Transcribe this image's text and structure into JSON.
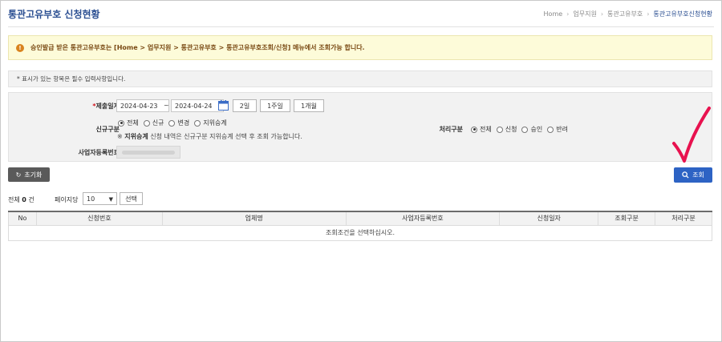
{
  "header": {
    "title": "통관고유부호 신청현황",
    "breadcrumb": [
      "Home",
      "업무지원",
      "통관고유부호",
      "통관고유부호신청현황"
    ]
  },
  "notice": {
    "text": "승인발급 받은 통관고유부호는 [Home > 업무지원 > 통관고유부호 > 통관고유부호조회/신청] 메뉴에서 조회가능 합니다."
  },
  "required_note": "* 표시가 있는 항목은 필수 입력사항입니다.",
  "form": {
    "submit_date": {
      "required_mark": "*",
      "label": "제출일자",
      "from": "2024-04-23",
      "tilde": "~",
      "to": "2024-04-24",
      "quick_buttons": [
        "2일",
        "1주일",
        "1개월"
      ]
    },
    "new_type": {
      "label": "신규구분",
      "options": [
        "전체",
        "신규",
        "변경",
        "지위승계"
      ],
      "selected": "전체",
      "hint_prefix": "※",
      "hint_bold": "지위승계",
      "hint_rest": "신청 내역은 신규구분 지위승계 선택 후 조회 가능합니다."
    },
    "process_type": {
      "label": "처리구분",
      "options": [
        "전체",
        "신청",
        "승인",
        "반려"
      ],
      "selected": "전체"
    },
    "business_no": {
      "label": "사업자등록번호"
    }
  },
  "actions": {
    "reset_label": "초기화",
    "query_label": "조회"
  },
  "list": {
    "total_prefix": "전체",
    "total_count": "0",
    "total_suffix": "건",
    "per_page_label": "페이지당",
    "per_page_value": "10",
    "select_label": "선택",
    "columns": [
      "No",
      "신청번호",
      "업체명",
      "사업자등록번호",
      "신청일자",
      "조회구분",
      "처리구분"
    ],
    "empty_message": "조회조건을 선택하십시오."
  },
  "colors": {
    "title": "#2b4f92",
    "query_button": "#2d63c4",
    "reset_button": "#5a5a5a",
    "notice_bg": "#fdfbd9",
    "required": "#d0121b",
    "annotation": "#e8124f"
  }
}
